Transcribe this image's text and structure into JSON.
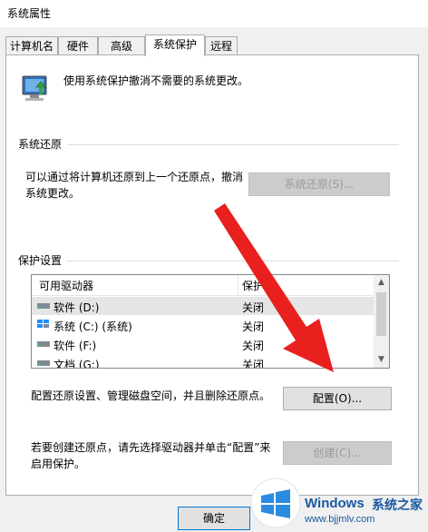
{
  "window": {
    "title": "系统属性"
  },
  "tabs": [
    {
      "label": "计算机名",
      "active": false
    },
    {
      "label": "硬件",
      "active": false
    },
    {
      "label": "高级",
      "active": false
    },
    {
      "label": "系统保护",
      "active": true
    },
    {
      "label": "远程",
      "active": false
    }
  ],
  "intro": {
    "text": "使用系统保护撤消不需要的系统更改。",
    "icon": "system-protection-icon"
  },
  "restore": {
    "group_title": "系统还原",
    "desc_line1": "可以通过将计算机还原到上一个还原点，撤消",
    "desc_line2": "系统更改。",
    "button": "系统还原(S)..."
  },
  "protection": {
    "group_title": "保护设置",
    "columns": [
      "可用驱动器",
      "保护"
    ],
    "drives": [
      {
        "name": "软件 (D:)",
        "protection": "关闭",
        "icon": "drive-icon"
      },
      {
        "name": "系统 (C:) (系统)",
        "protection": "关闭",
        "icon": "system-drive-icon"
      },
      {
        "name": "软件 (F:)",
        "protection": "关闭",
        "icon": "drive-icon"
      },
      {
        "name": "文档 (G:)",
        "protection": "关闭",
        "icon": "drive-icon"
      }
    ],
    "config_desc": "配置还原设置、管理磁盘空间，并且删除还原点。",
    "config_button": "配置(O)...",
    "create_desc_line1": "若要创建还原点，请先选择驱动器并单击“配置”来",
    "create_desc_line2": "启用保护。",
    "create_button": "创建(C)..."
  },
  "footer": {
    "ok_button": "确定"
  },
  "watermark": {
    "brand": "Windows",
    "text": "系统之家",
    "url": "www.bjjmlv.com"
  },
  "colors": {
    "arrow": "#e8201e",
    "accent": "#0078d7"
  }
}
